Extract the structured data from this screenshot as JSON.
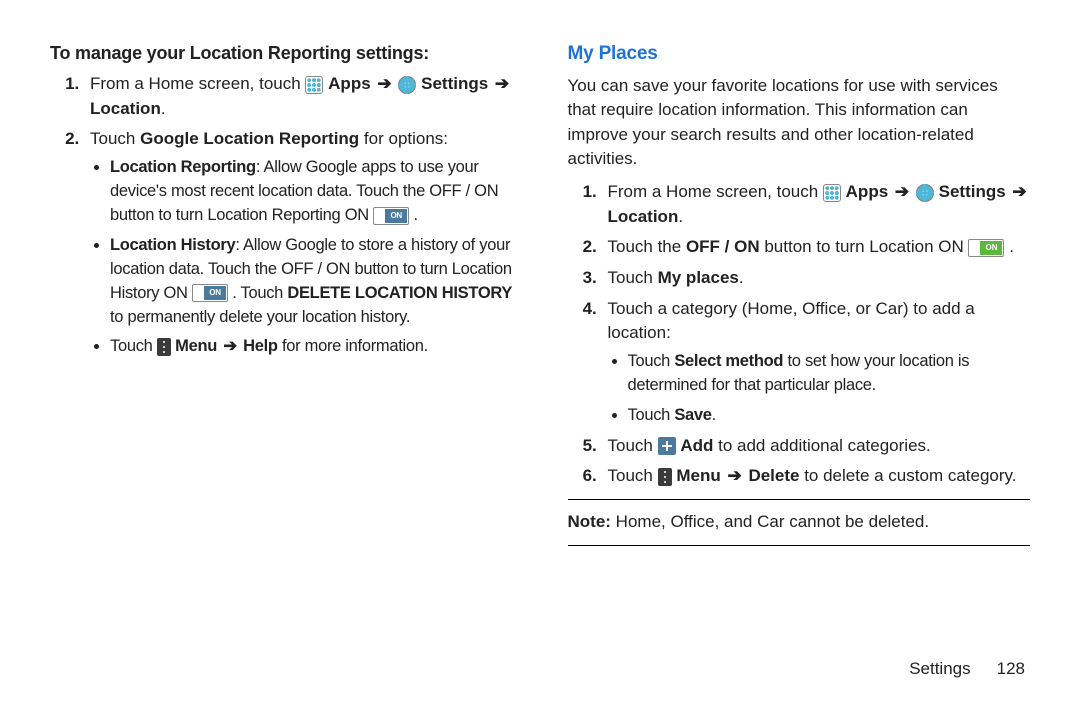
{
  "left": {
    "heading": "To manage your Location Reporting settings:",
    "step1_prefix": "From a Home screen, touch ",
    "apps_label": "Apps",
    "settings_label": "Settings",
    "location_label": "Location",
    "step2_prefix": "Touch ",
    "step2_bold": "Google Location Reporting",
    "step2_suffix": " for options:",
    "b1_title": "Location Reporting",
    "b1_text_a": ": Allow Google apps to use your device's most recent location data. Touch the OFF / ON button to turn Location Reporting ON ",
    "b2_title": "Location History",
    "b2_text_a": ": Allow Google to store a history of your location data. Touch the OFF / ON button to turn Location History ON ",
    "b2_text_b": " . Touch ",
    "b2_bold": "DELETE LOCATION HISTORY",
    "b2_text_c": " to permanently delete your location history.",
    "b3_prefix": "Touch ",
    "b3_menu": "Menu",
    "b3_help": "Help",
    "b3_suffix": " for more information."
  },
  "right": {
    "heading": "My Places",
    "intro": "You can save your favorite locations for use with services that require location information. This information can improve your search results and other location-related activities.",
    "step1_prefix": "From a Home screen, touch ",
    "apps_label": "Apps",
    "settings_label": "Settings",
    "location_label": "Location",
    "step2_a": "Touch the ",
    "step2_bold": "OFF / ON",
    "step2_b": " button to turn Location ON ",
    "step3_a": "Touch ",
    "step3_bold": "My places",
    "step4": "Touch a category (Home, Office, or Car) to add a location:",
    "sb1_a": "Touch ",
    "sb1_bold": "Select method",
    "sb1_b": " to set how your location is determined for that particular place.",
    "sb2_a": "Touch ",
    "sb2_bold": "Save",
    "step5_a": "Touch ",
    "step5_bold": "Add",
    "step5_b": " to add additional categories.",
    "step6_a": "Touch ",
    "step6_menu": "Menu",
    "step6_delete": "Delete",
    "step6_b": " to delete a custom category.",
    "note_label": "Note:",
    "note_text": " Home, Office, and Car cannot be deleted."
  },
  "footer": {
    "section": "Settings",
    "page": "128"
  },
  "arrow": "➔"
}
